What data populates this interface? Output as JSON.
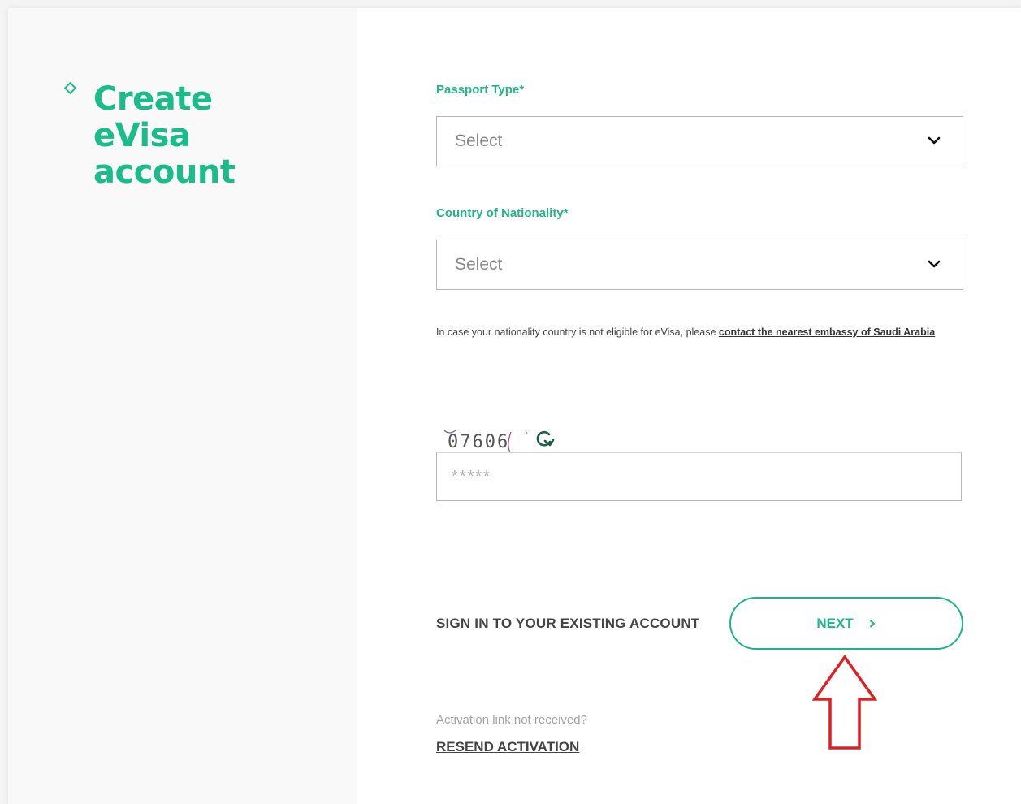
{
  "sidebar": {
    "title_lines": [
      "Create",
      "eVisa",
      "account"
    ]
  },
  "form": {
    "passport_type": {
      "label": "Passport Type*",
      "value": "Select"
    },
    "nationality": {
      "label": "Country of Nationality*",
      "value": "Select"
    },
    "note": {
      "text": "In case your nationality country is not eligible for eVisa, please ",
      "link": "contact the nearest embassy of Saudi Arabia"
    },
    "captcha": {
      "code": "07606",
      "placeholder": "*****"
    }
  },
  "actions": {
    "sign_in": "SIGN IN TO YOUR EXISTING ACCOUNT",
    "next": "NEXT",
    "activation_prompt": "Activation link not received?",
    "resend": "RESEND ACTIVATION"
  },
  "icons": {
    "diamond": "diamond-bullet-icon",
    "dropdown": "chevron-down-icon",
    "refresh": "refresh-icon",
    "next": "chevron-right-icon",
    "annotation": "up-arrow-annotation-icon"
  },
  "colors": {
    "accent": "#1ab58a",
    "annotation_arrow": "#e02020",
    "sidebar_bg": "#f9f9f9"
  }
}
